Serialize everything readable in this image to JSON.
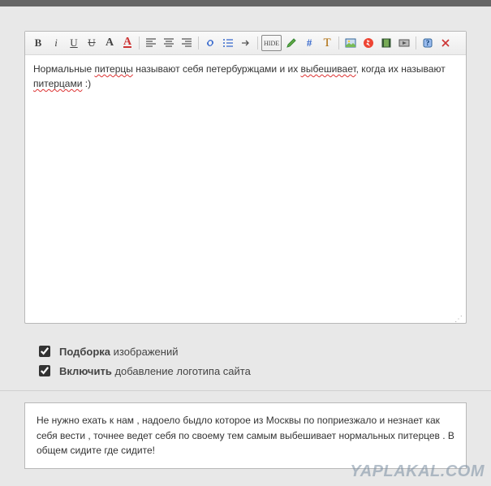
{
  "toolbar": {
    "bold": "B",
    "italic": "i",
    "underline": "U",
    "strike": "U",
    "font_size": "A",
    "font_color": "A",
    "hide_label": "HIDE",
    "hash": "#",
    "text_tool": "T"
  },
  "editor": {
    "text_part1": "Нормальные ",
    "text_spell1": "питерцы",
    "text_part2": " называют себя петербуржцами и их ",
    "text_spell2": "выбешивает",
    "text_part3": ", когда их называют ",
    "text_spell3": "питерцами",
    "text_part4": "  :)"
  },
  "options": {
    "podborka_bold": "Подборка",
    "podborka_rest": " изображений",
    "logo_bold": "Включить",
    "logo_rest": " добавление логотипа сайта"
  },
  "preview": {
    "text": "Не нужно ехать к нам , надоело быдло которое из Москвы по поприезжало и незнает как себя вести , точнее ведет себя по своему тем самым выбешивает нормальных питерцев . В общем сидите где сидите!"
  },
  "watermark": "YAPLAKAL.COM"
}
